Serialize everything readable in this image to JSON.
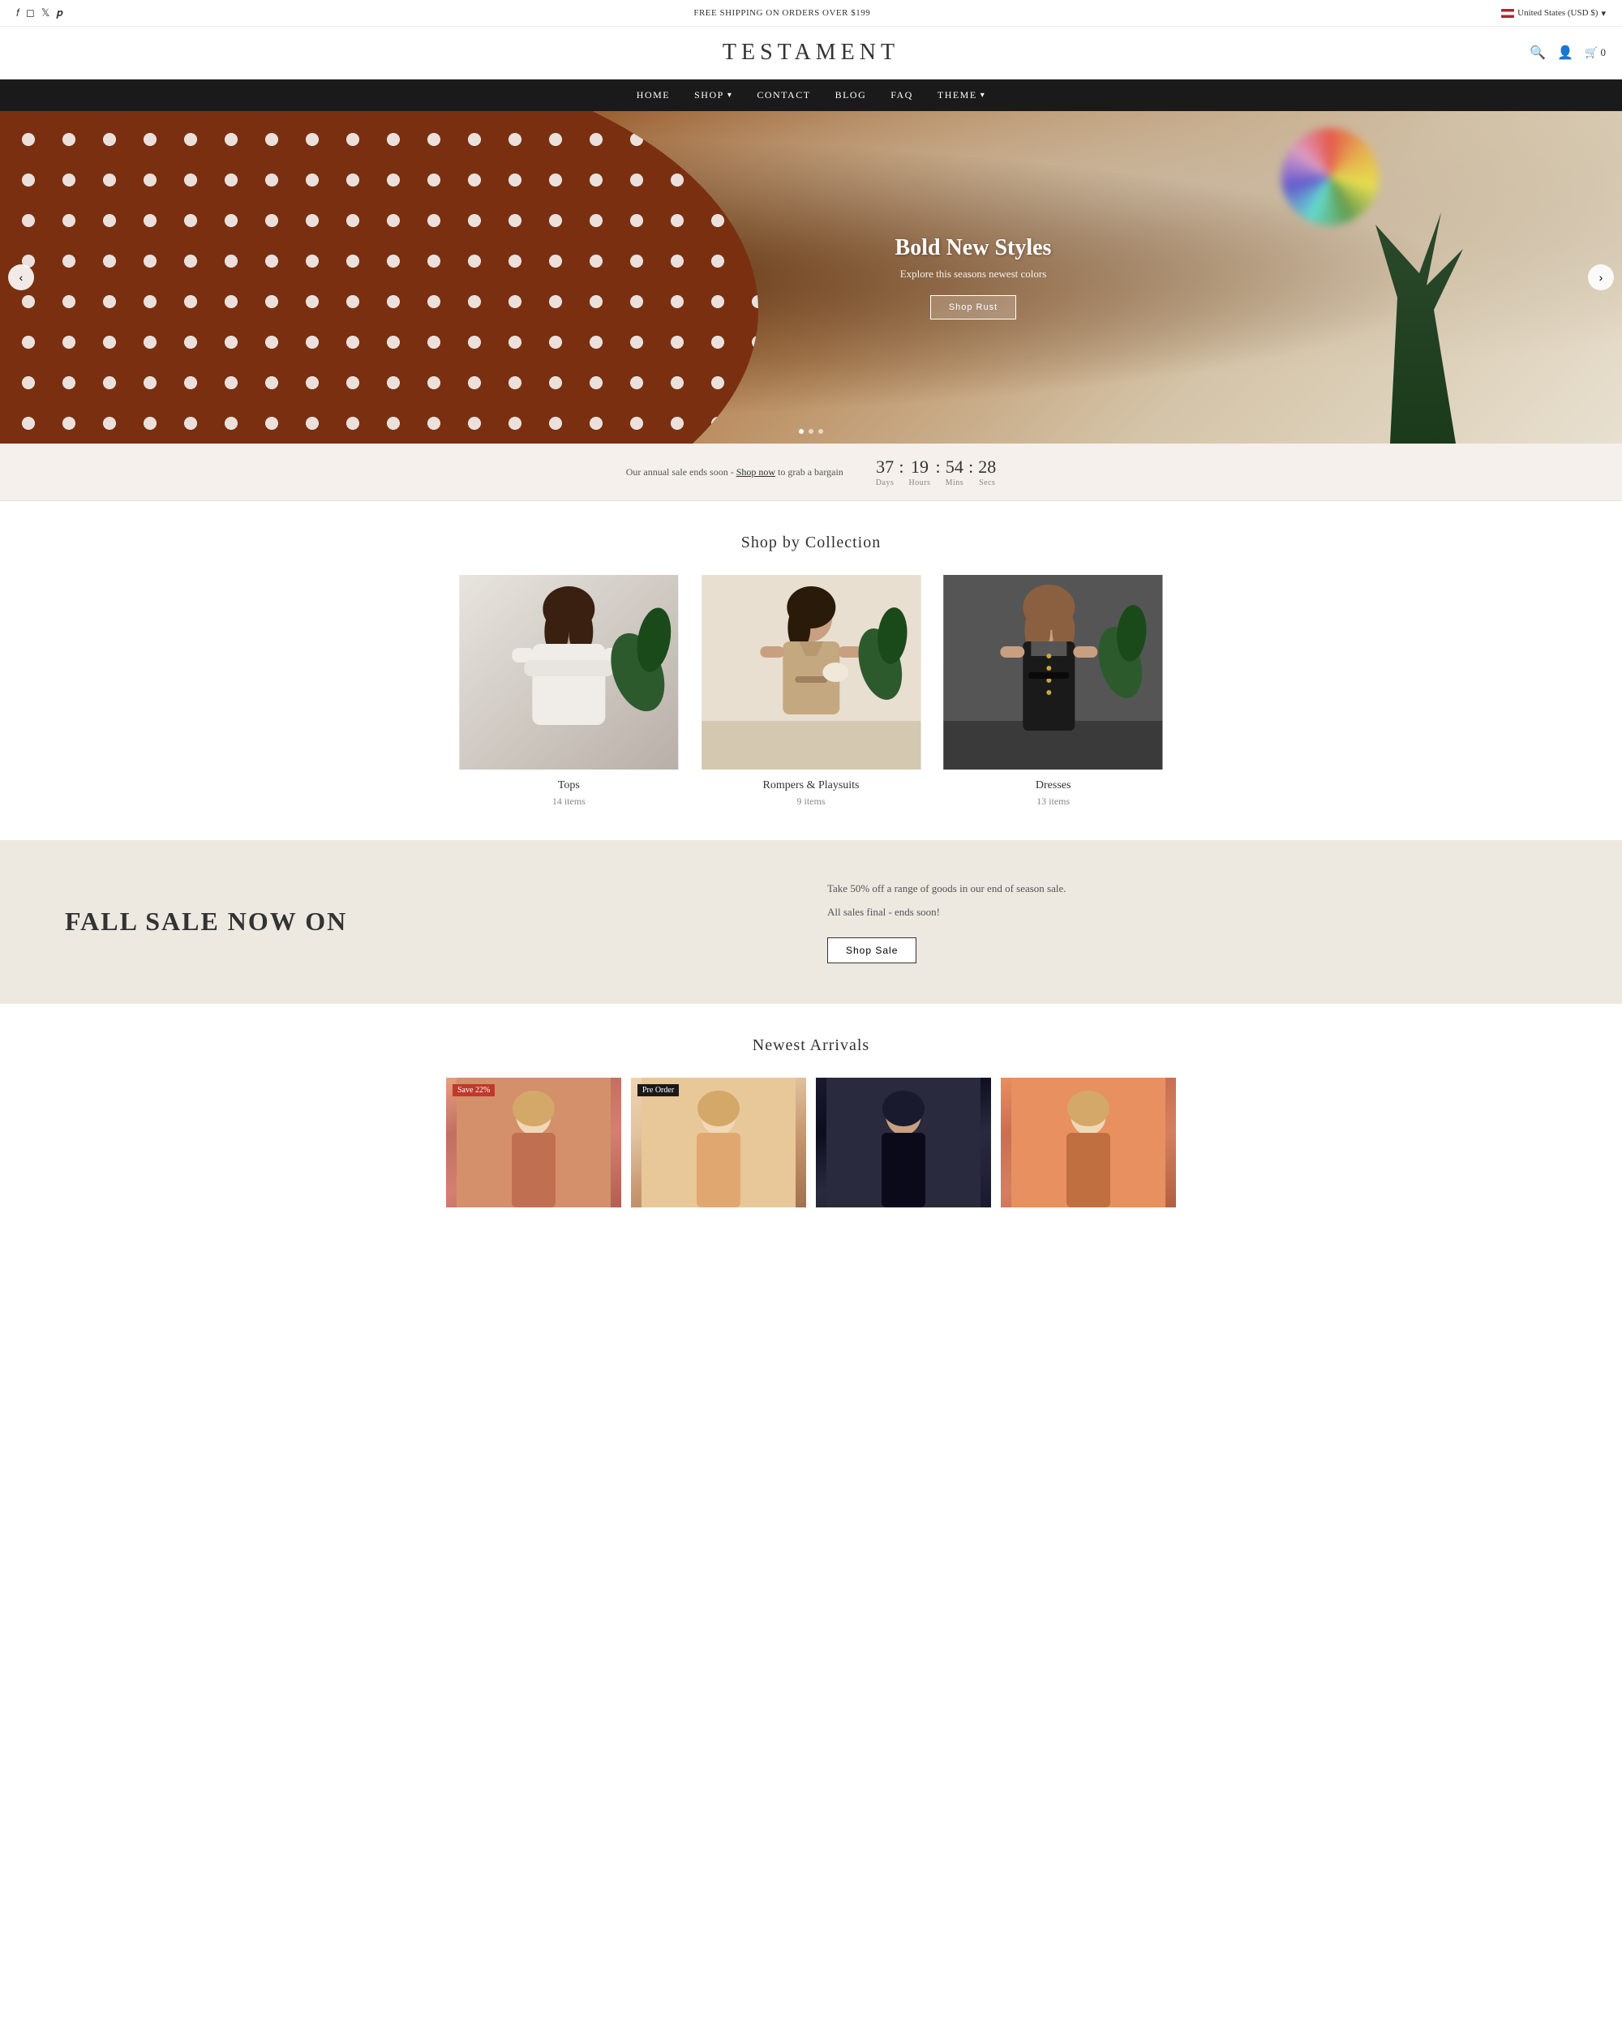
{
  "topbar": {
    "shipping_notice": "FREE SHIPPING ON ORDERS OVER $199",
    "region": "United States (USD $)"
  },
  "header": {
    "logo": "TESTAMENT",
    "cart_count": "0"
  },
  "nav": {
    "items": [
      {
        "label": "HOME",
        "has_dropdown": false
      },
      {
        "label": "SHOP",
        "has_dropdown": true
      },
      {
        "label": "CONTACT",
        "has_dropdown": false
      },
      {
        "label": "BLOG",
        "has_dropdown": false
      },
      {
        "label": "FAQ",
        "has_dropdown": false
      },
      {
        "label": "THEME",
        "has_dropdown": true
      }
    ]
  },
  "hero": {
    "title": "Bold New Styles",
    "subtitle": "Explore this seasons newest colors",
    "cta_label": "Shop Rust"
  },
  "countdown": {
    "message": "Our annual sale ends soon - ",
    "link_text": "Shop now",
    "link_suffix": " to grab a bargain",
    "days": "37",
    "hours": "19",
    "mins": "54",
    "secs": "28",
    "label_days": "Days",
    "label_hours": "Hours",
    "label_mins": "Mins",
    "label_secs": "Secs"
  },
  "collections": {
    "section_title": "Shop by Collection",
    "items": [
      {
        "name": "Tops",
        "count": "14 items"
      },
      {
        "name": "Rompers & Playsuits",
        "count": "9 items"
      },
      {
        "name": "Dresses",
        "count": "13 items"
      }
    ]
  },
  "fall_sale": {
    "title": "FALL SALE NOW ON",
    "description_1": "Take 50% off a range of goods in our end of season sale.",
    "description_2": "All sales final - ends soon!",
    "cta_label": "Shop Sale"
  },
  "newest_arrivals": {
    "section_title": "Newest Arrivals",
    "badge_save": "Save 22%",
    "badge_preorder": "Pre Order",
    "items": [
      {
        "has_save_badge": true,
        "has_preorder_badge": false
      },
      {
        "has_save_badge": false,
        "has_preorder_badge": true
      },
      {
        "has_save_badge": false,
        "has_preorder_badge": false
      },
      {
        "has_save_badge": false,
        "has_preorder_badge": false
      }
    ]
  },
  "social": {
    "icons": [
      "f",
      "📷",
      "🐦",
      "📌"
    ]
  }
}
